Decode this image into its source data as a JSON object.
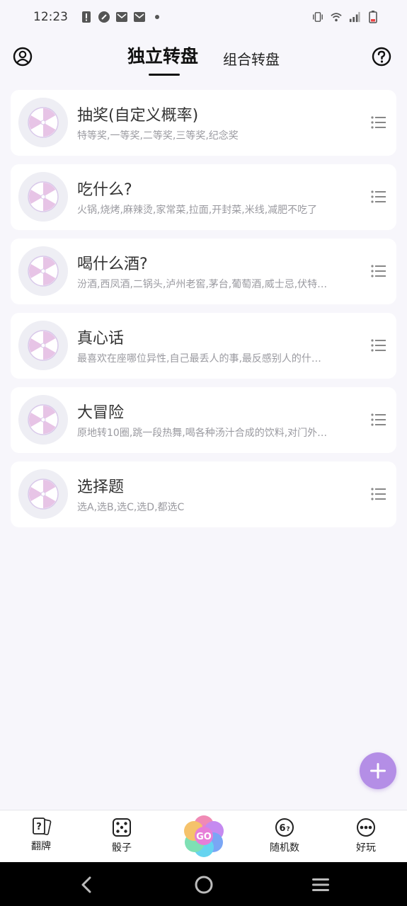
{
  "status_bar": {
    "time": "12:23",
    "icons_left": [
      "alert-icon",
      "app-icon",
      "mail-icon",
      "mail-icon",
      "dot-icon"
    ],
    "icons_right": [
      "vibrate-icon",
      "wifi-icon",
      "signal-icon",
      "battery-icon"
    ]
  },
  "header": {
    "tab_active": "独立转盘",
    "tab_inactive": "组合转盘"
  },
  "wheels": [
    {
      "title": "抽奖(自定义概率)",
      "subtitle": "特等奖,一等奖,二等奖,三等奖,纪念奖"
    },
    {
      "title": "吃什么?",
      "subtitle": "火锅,烧烤,麻辣烫,家常菜,拉面,开封菜,米线,减肥不吃了"
    },
    {
      "title": "喝什么酒?",
      "subtitle": "汾酒,西凤酒,二锅头,泸州老窖,茅台,葡萄酒,威士忌,伏特…"
    },
    {
      "title": "真心话",
      "subtitle": "最喜欢在座哪位异性,自己最丢人的事,最反感别人的什…"
    },
    {
      "title": "大冒险",
      "subtitle": "原地转10圈,跳一段热舞,喝各种汤汁合成的饮料,对门外…"
    },
    {
      "title": "选择题",
      "subtitle": "选A,选B,选C,选D,都选C"
    }
  ],
  "bottom_nav": {
    "flip": "翻牌",
    "dice": "骰子",
    "go": "GO",
    "random": "随机数",
    "fun": "好玩"
  },
  "colors": {
    "accent": "#b48ee6",
    "wheel_pink": "#e7c4e6",
    "wheel_purple": "#c7b0e6"
  }
}
